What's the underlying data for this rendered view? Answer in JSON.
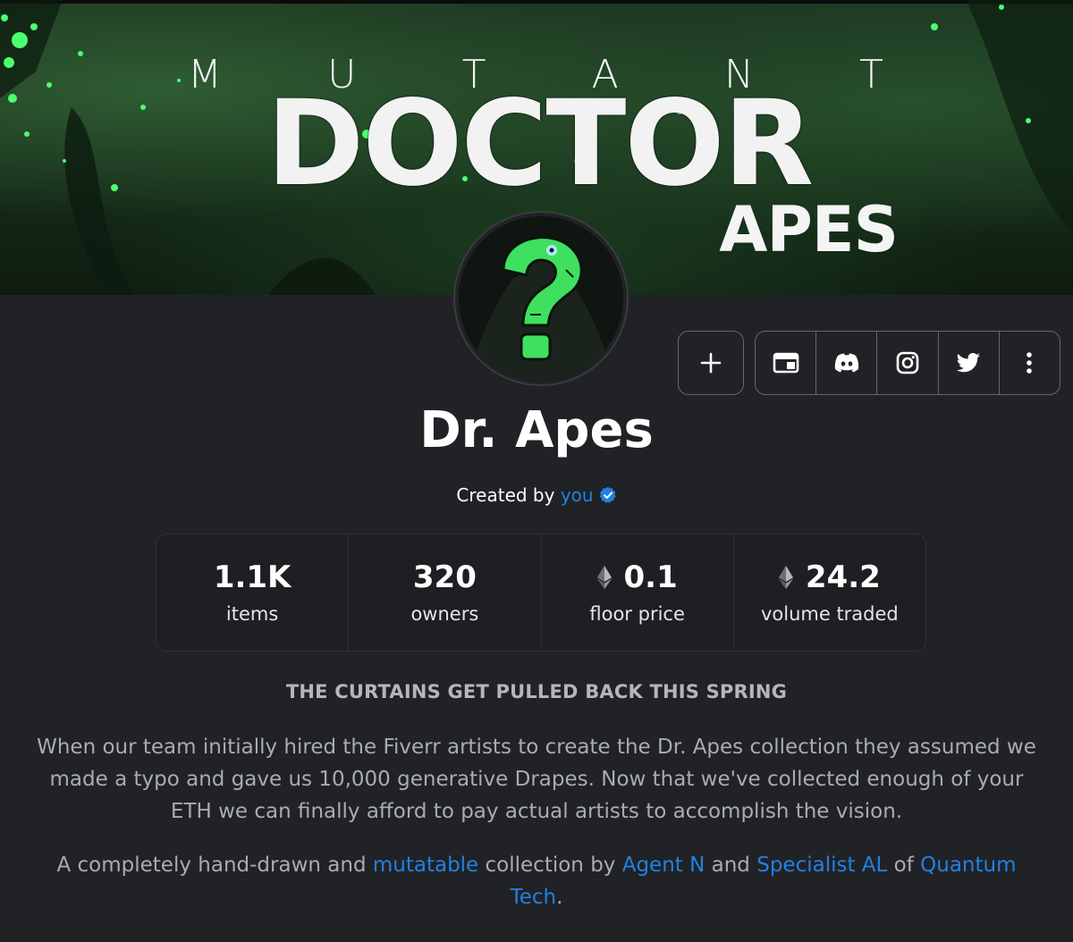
{
  "banner": {
    "line1_letters": [
      "M",
      "U",
      "T",
      "A",
      "N",
      "T"
    ],
    "line2": "DOCTOR",
    "line3": "APES"
  },
  "actions": {
    "add_label": "+",
    "icons": [
      "website-icon",
      "discord-icon",
      "instagram-icon",
      "twitter-icon",
      "more-vertical-icon"
    ]
  },
  "collection": {
    "name": "Dr. Apes",
    "created_by_prefix": "Created by",
    "creator": "you"
  },
  "stats": [
    {
      "value": "1.1K",
      "label": "items",
      "eth": false
    },
    {
      "value": "320",
      "label": "owners",
      "eth": false
    },
    {
      "value": "0.1",
      "label": "floor price",
      "eth": true
    },
    {
      "value": "24.2",
      "label": "volume traded",
      "eth": true
    }
  ],
  "description": {
    "headline": "THE CURTAINS GET PULLED BACK THIS SPRING",
    "paragraph1": "When our team initially hired the Fiverr artists to create the Dr. Apes collection they assumed we made a typo and gave us 10,000 generative Drapes. Now that we've collected enough of your ETH we can finally afford to pay actual artists to accomplish the vision.",
    "p2_part1": "A completely hand-drawn and ",
    "p2_link1": "mutatable",
    "p2_part2": " collection by ",
    "p2_link2": "Agent N",
    "p2_part3": " and ",
    "p2_link3": "Specialist AL",
    "p2_part4": " of ",
    "p2_link4": "Quantum Tech",
    "p2_part5": "."
  },
  "colors": {
    "background": "#202225",
    "link": "#2081e2",
    "accent_green": "#3fe060"
  }
}
